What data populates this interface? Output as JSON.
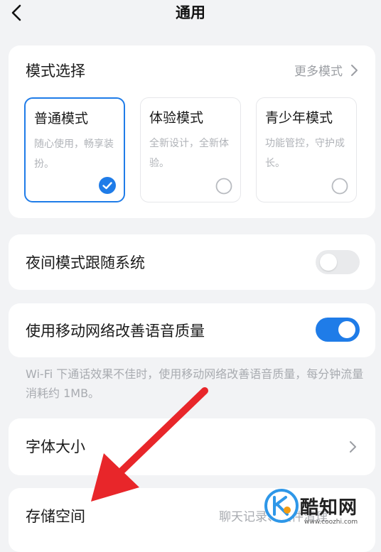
{
  "header": {
    "title": "通用",
    "back_icon": "chevron-left-icon"
  },
  "mode_section": {
    "title": "模式选择",
    "more_label": "更多模式",
    "options": [
      {
        "title": "普通模式",
        "desc": "随心使用，畅享装扮。",
        "selected": true
      },
      {
        "title": "体验模式",
        "desc": "全新设计，全新体验。",
        "selected": false
      },
      {
        "title": "青少年模式",
        "desc": "功能管控，守护成长。",
        "selected": false
      }
    ]
  },
  "night_mode": {
    "label": "夜间模式跟随系统",
    "enabled": false
  },
  "voice_quality": {
    "label": "使用移动网络改善语音质量",
    "enabled": true,
    "note": "Wi-Fi 下通话效果不佳时，使用移动网络改善语音质量，每分钟流量消耗约 1MB。"
  },
  "font_size": {
    "label": "字体大小"
  },
  "storage": {
    "label": "存储空间",
    "value": "聊天记录、文件清理"
  },
  "watermark": {
    "text": "酷知网",
    "url": "www.coozhi.com"
  },
  "colors": {
    "accent": "#1f7ce8",
    "background": "#f2f3f5",
    "annotation_arrow": "#e8262a"
  }
}
